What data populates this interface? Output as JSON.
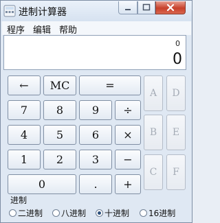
{
  "window": {
    "title": "进制计算器"
  },
  "menu": [
    "程序",
    "编辑",
    "帮助"
  ],
  "display": {
    "memory": "0",
    "value": "0"
  },
  "keys": {
    "back": "←",
    "mc": "MC",
    "equals": "=",
    "n7": "7",
    "n8": "8",
    "n9": "9",
    "div": "÷",
    "n4": "4",
    "n5": "5",
    "n6": "6",
    "mul": "×",
    "n1": "1",
    "n2": "2",
    "n3": "3",
    "sub": "−",
    "n0": "0",
    "dot": ".",
    "add": "+",
    "hexA": "A",
    "hexB": "B",
    "hexC": "C",
    "hexD": "D",
    "hexE": "E",
    "hexF": "F"
  },
  "base_section": {
    "label": "进制"
  },
  "bases": [
    {
      "label": "二进制",
      "selected": false
    },
    {
      "label": "八进制",
      "selected": false
    },
    {
      "label": "十进制",
      "selected": true
    },
    {
      "label": "16进制",
      "selected": false
    }
  ]
}
